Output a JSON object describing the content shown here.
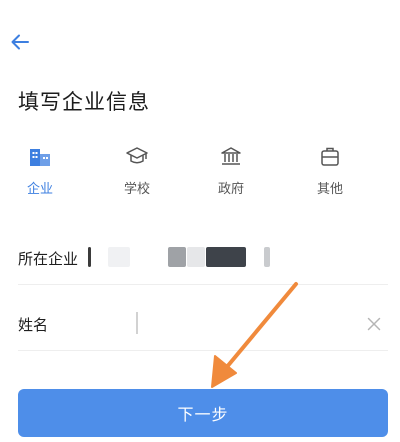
{
  "header": {
    "back_icon": "arrow-left-icon"
  },
  "page": {
    "title": "填写企业信息"
  },
  "type_tabs": [
    {
      "label": "企业",
      "icon": "building-icon",
      "active": true
    },
    {
      "label": "学校",
      "icon": "graduation-cap-icon",
      "active": false
    },
    {
      "label": "政府",
      "icon": "government-building-icon",
      "active": false
    },
    {
      "label": "其他",
      "icon": "briefcase-icon",
      "active": false
    }
  ],
  "form": {
    "company_label": "所在企业",
    "name_label": "姓名",
    "name_value": "",
    "clear_icon": "close-icon"
  },
  "actions": {
    "next_label": "下一步"
  },
  "colors": {
    "accent": "#3d7fe0",
    "button": "#4e8ee9",
    "annotation_arrow": "#f08a3c"
  }
}
